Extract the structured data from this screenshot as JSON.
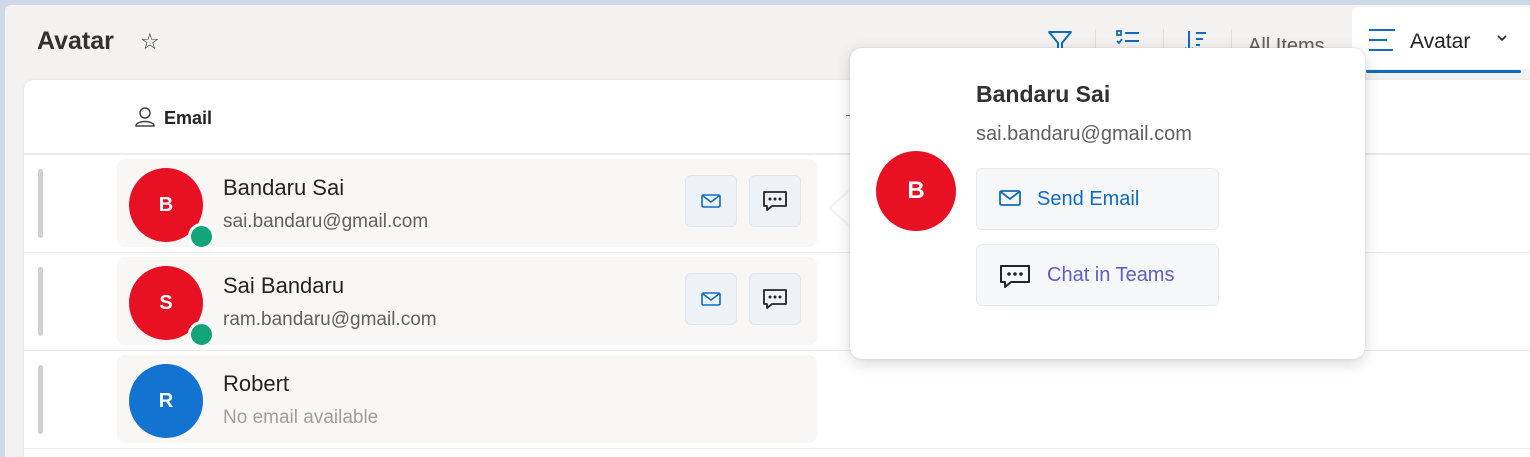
{
  "header": {
    "title": "Avatar",
    "favorite_icon": "star-outline-icon",
    "toolbar_icons": [
      "filter-icon",
      "list-icon",
      "sort-icon"
    ],
    "view_selector_label": "All Items",
    "active_view": "Avatar"
  },
  "grid": {
    "column_header": "Email",
    "rows": [
      {
        "initial": "B",
        "name": "Bandaru Sai",
        "email": "sai.bandaru@gmail.com",
        "avatar_color": "#e81123",
        "presence": "available",
        "has_actions": true
      },
      {
        "initial": "S",
        "name": "Sai Bandaru",
        "email": "ram.bandaru@gmail.com",
        "avatar_color": "#e81123",
        "presence": "available",
        "has_actions": true
      },
      {
        "initial": "R",
        "name": "Robert",
        "email": "No email available",
        "avatar_color": "#1273d1",
        "presence": null,
        "has_actions": false
      }
    ]
  },
  "popup": {
    "initial": "B",
    "name": "Bandaru Sai",
    "email": "sai.bandaru@gmail.com",
    "avatar_color": "#e81123",
    "send_email_label": "Send Email",
    "chat_label": "Chat in Teams"
  },
  "colors": {
    "accent": "#0f6cbd",
    "send_email": "#0f6cbd",
    "teams": "#5b5fc7",
    "presence_available": "#13a579"
  }
}
